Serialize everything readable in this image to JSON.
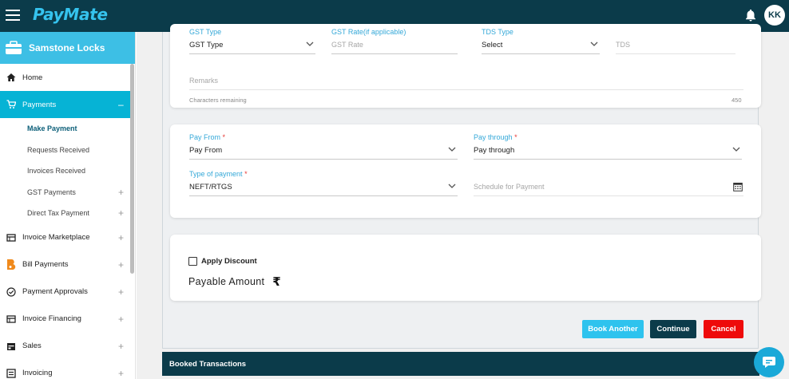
{
  "app": {
    "brand": "PayMate",
    "user_initials": "KK"
  },
  "sidebar": {
    "company": "Samstone Locks",
    "items": [
      {
        "label": "Home",
        "icon": "home-icon"
      },
      {
        "label": "Payments",
        "icon": "cart-icon",
        "toggle": "–"
      },
      {
        "label": "Invoice Marketplace",
        "icon": "marketplace-icon",
        "toggle": "+"
      },
      {
        "label": "Bill Payments",
        "icon": "bill-icon",
        "toggle": "+"
      },
      {
        "label": "Payment Approvals",
        "icon": "approval-icon",
        "toggle": "+"
      },
      {
        "label": "Invoice Financing",
        "icon": "financing-icon",
        "toggle": "+"
      },
      {
        "label": "Sales",
        "icon": "sales-icon",
        "toggle": "+"
      },
      {
        "label": "Invoicing",
        "icon": "invoicing-icon",
        "toggle": "+"
      }
    ],
    "payments_sub": [
      {
        "label": "Make Payment"
      },
      {
        "label": "Requests Received"
      },
      {
        "label": "Invoices Received"
      },
      {
        "label": "GST Payments",
        "toggle": "+"
      },
      {
        "label": "Direct Tax Payment",
        "toggle": "+"
      }
    ]
  },
  "form_top": {
    "gst_type": {
      "label": "GST Type",
      "value": "GST Type"
    },
    "gst_rate": {
      "label": "GST Rate(if applicable)",
      "placeholder": "GST Rate"
    },
    "tds_type": {
      "label": "TDS Type",
      "value": "Select"
    },
    "tds": {
      "placeholder": "TDS"
    },
    "remarks": {
      "placeholder": "Remarks",
      "hint": "Characters remaining",
      "count": "450"
    }
  },
  "form_pay": {
    "pay_from": {
      "label": "Pay From",
      "value": "Pay From"
    },
    "pay_through": {
      "label": "Pay through",
      "value": "Pay through"
    },
    "type_of_payment": {
      "label": "Type of payment",
      "value": "NEFT/RTGS"
    },
    "schedule": {
      "placeholder": "Schedule for Payment"
    },
    "required_mark": "*"
  },
  "discount": {
    "checkbox_label": "Apply Discount",
    "payable_label": "Payable Amount",
    "currency": "₹"
  },
  "actions": {
    "book_another": "Book Another",
    "continue": "Continue",
    "cancel": "Cancel"
  },
  "booked": {
    "title": "Booked Transactions"
  },
  "colors": {
    "topbar": "#0b3b4a",
    "accent": "#06b3d5",
    "cancel": "#ee0b0b"
  }
}
